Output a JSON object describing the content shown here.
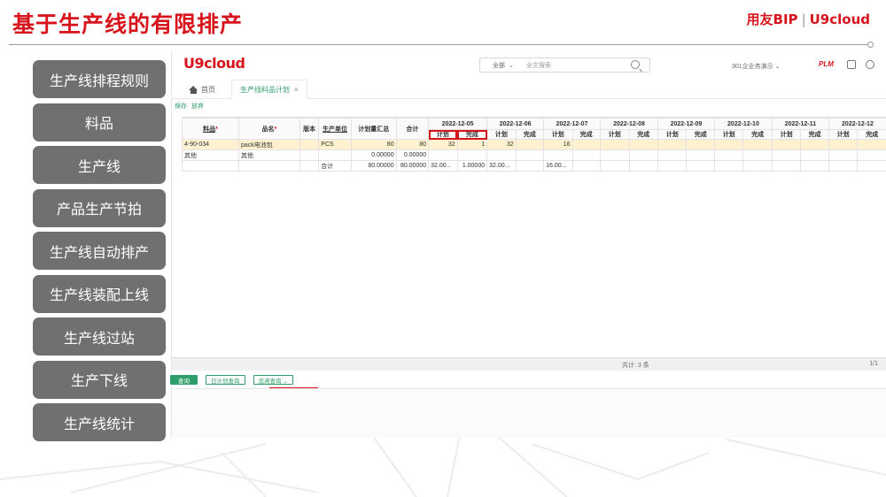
{
  "slide": {
    "title": "基于生产线的有限排产",
    "brand_left": "用友BIP",
    "brand_sep": "|",
    "brand_right": "U9cloud"
  },
  "side_nav": [
    {
      "label": "生产线排程规则",
      "name": "nav-production-line-rules"
    },
    {
      "label": "料品",
      "name": "nav-items"
    },
    {
      "label": "生产线",
      "name": "nav-production-line"
    },
    {
      "label": "产品生产节拍",
      "name": "nav-production-takt"
    },
    {
      "label": "生产线自动排产",
      "name": "nav-auto-scheduling"
    },
    {
      "label": "生产线装配上线",
      "name": "nav-assembly-online"
    },
    {
      "label": "生产线过站",
      "name": "nav-station-pass"
    },
    {
      "label": "生产下线",
      "name": "nav-production-offline"
    },
    {
      "label": "生产线统计",
      "name": "nav-line-statistics"
    }
  ],
  "app": {
    "logo": "U9cloud",
    "search": {
      "scope": "全部",
      "scope_chevron": "⌄",
      "placeholder": "全文搜索"
    },
    "org": "301企业务演示 ⌄",
    "plm": "PLM",
    "tabs": {
      "home": "首页",
      "active": "生产线料品计划",
      "close": "×"
    },
    "toolbar": {
      "save": "保存",
      "discard": "放弃"
    },
    "grid": {
      "columns": {
        "item": "料品",
        "name": "品名",
        "version": "版本",
        "unit": "生产单位",
        "plan_total": "计划量汇总",
        "sum": "合计",
        "plan": "计划",
        "done": "完成"
      },
      "required_mark": "*",
      "dates": [
        "2022-12-05",
        "2022-12-06",
        "2022-12-07",
        "2022-12-08",
        "2022-12-09",
        "2022-12-10",
        "2022-12-11",
        "2022-12-12"
      ],
      "rows": [
        {
          "item": "4-90-034",
          "name": "pack电池包",
          "version": "",
          "unit": "PCS",
          "plan_total": "80",
          "sum": "80",
          "cells": [
            "32",
            "1",
            "32",
            "",
            "16",
            "",
            "",
            "",
            "",
            "",
            "",
            "",
            "",
            "",
            "",
            ""
          ]
        },
        {
          "item": "其他",
          "name": "其他",
          "version": "",
          "unit": "",
          "plan_total": "0.00000",
          "sum": "0.00000",
          "cells": [
            "",
            "",
            "",
            "",
            "",
            "",
            "",
            "",
            "",
            "",
            "",
            "",
            "",
            "",
            "",
            ""
          ]
        },
        {
          "item": "",
          "name": "",
          "version": "",
          "unit": "合计",
          "plan_total": "80.00000",
          "sum": "80.00000",
          "cells": [
            "32.00...",
            "1.00000",
            "32.00...",
            "",
            "16.00...",
            "",
            "",
            "",
            "",
            "",
            "",
            "",
            "",
            "",
            "",
            ""
          ]
        }
      ],
      "total_count": "共计: 3 条",
      "pager": "1/1"
    },
    "bottom_buttons": {
      "query": "查询",
      "daily_plan": "日计划查询",
      "trace": "追溯查询 ⌄"
    }
  },
  "colors": {
    "accent_red": "#d7141c",
    "nav_gray": "#707070",
    "green": "#2f9e6b",
    "row_highlight": "#fdf1cf"
  }
}
